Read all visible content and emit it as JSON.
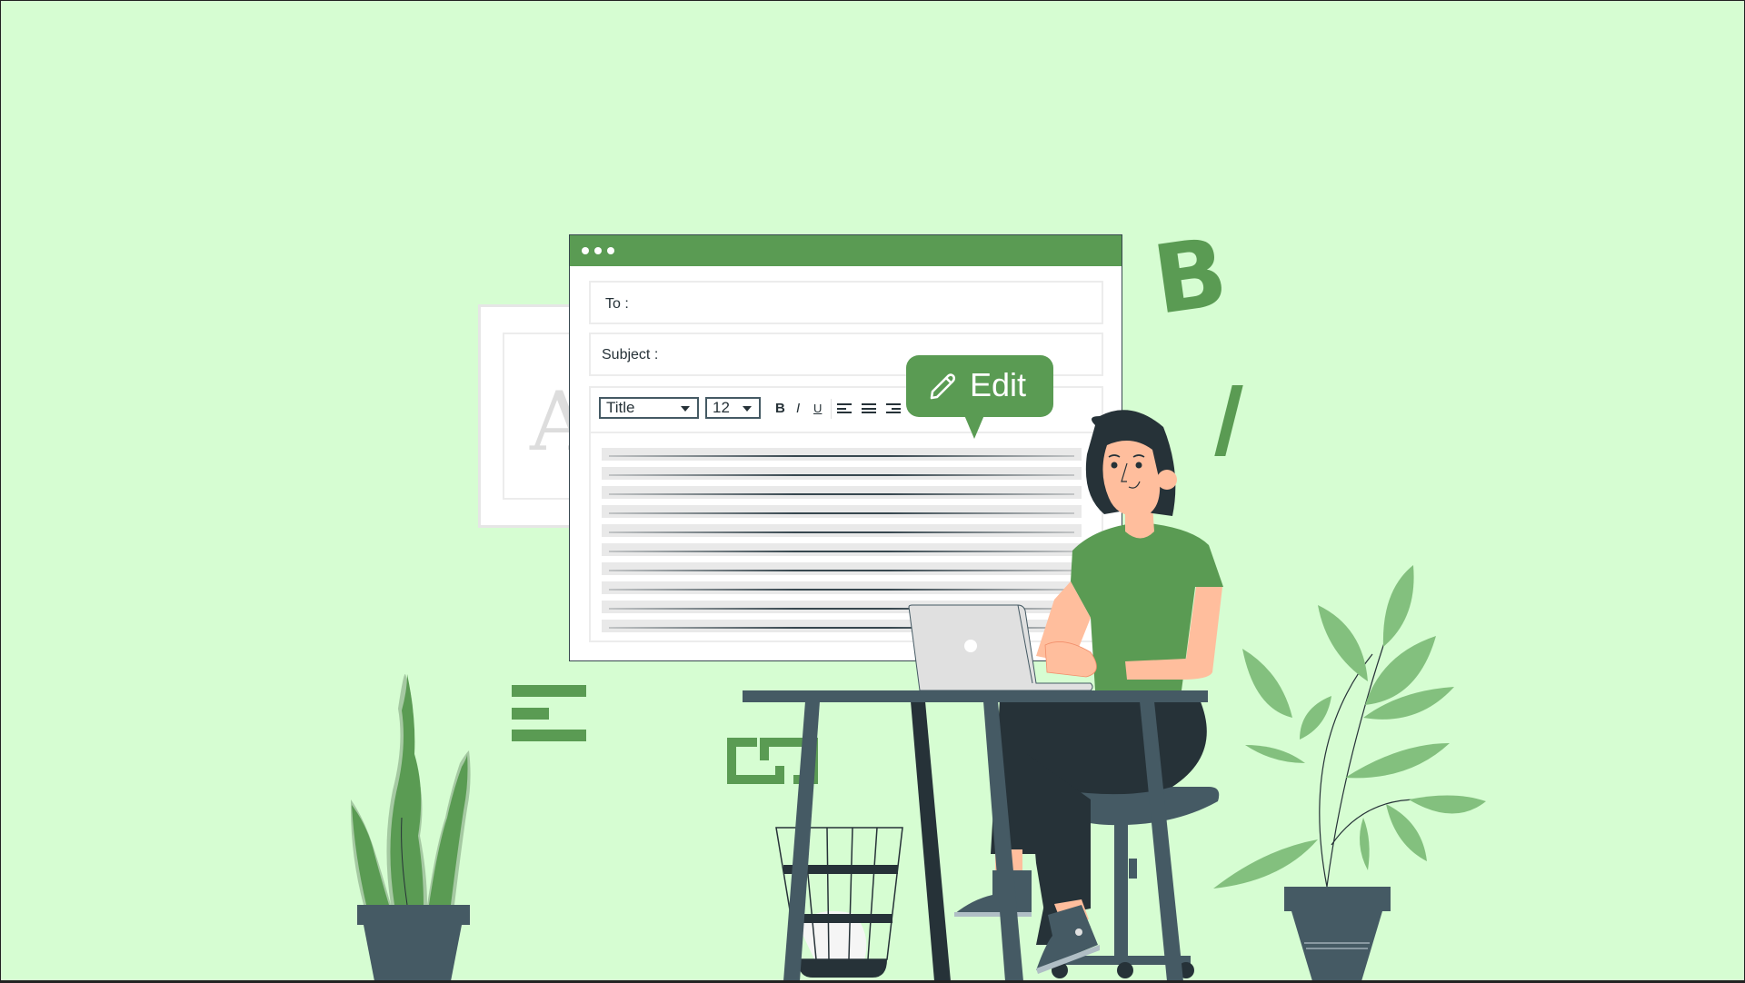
{
  "window": {
    "titlebar_dots": 3,
    "to_label": "To :",
    "to_value": "",
    "subject_label": "Subject :",
    "subject_value": "",
    "toolbar": {
      "style_select": "Title",
      "size_select": "12",
      "bold": "B",
      "italic": "I",
      "underline": "U",
      "align_buttons": [
        "align-left-icon",
        "align-center-icon",
        "align-right-icon"
      ]
    },
    "body_line_count": 10
  },
  "tooltip": {
    "label": "Edit",
    "icon": "pencil-icon"
  },
  "decorations": {
    "back_card_letter": "A",
    "floating_bold": "B",
    "floating_italic": "/",
    "floating_icons": [
      "align-left-icon",
      "crop-icon"
    ]
  },
  "colors": {
    "background": "#d6fdd2",
    "accent": "#5a9b53",
    "dark": "#263238",
    "slate": "#455a64",
    "skin": "#ffbe9d",
    "leaf_light": "#83c07e"
  }
}
